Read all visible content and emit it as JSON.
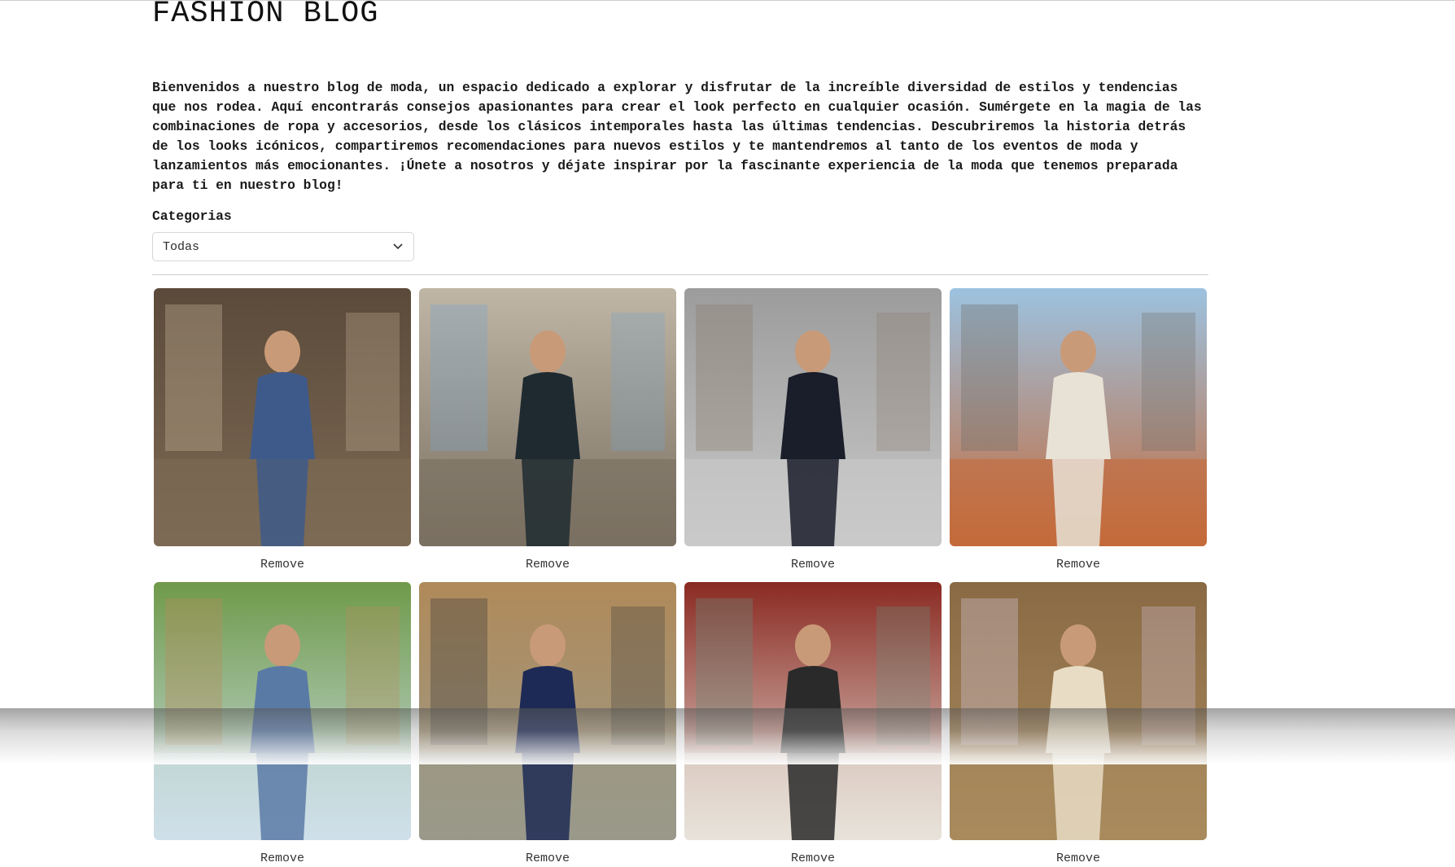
{
  "header": {
    "title": "FASHION BLOG"
  },
  "intro": {
    "text": "Bienvenidos a nuestro blog de moda, un espacio dedicado a explorar y disfrutar de la increíble diversidad de estilos y tendencias que nos rodea. Aquí encontrarás consejos apasionantes para crear el look perfecto en cualquier ocasión. Sumérgete en la magia de las combinaciones de ropa y accesorios, desde los clásicos intemporales hasta las últimas tendencias. Descubriremos la historia detrás de los looks icónicos, compartiremos recomendaciones para nuevos estilos y te mantendremos al tanto de los eventos de moda y lanzamientos más emocionantes. ¡Únete a nosotros y déjate inspirar por la fascinante experiencia de la moda que tenemos preparada para ti en nuestro blog!"
  },
  "filter": {
    "label": "Categorias",
    "selected": "Todas",
    "icon": "chevron-down-icon"
  },
  "posts": [
    {
      "remove_label": "Remove",
      "colors": [
        "#5b4a3a",
        "#7d6a55",
        "#3e5a8a",
        "#c9b79a"
      ]
    },
    {
      "remove_label": "Remove",
      "colors": [
        "#bfb6a6",
        "#7a6f60",
        "#1f2a30",
        "#7aa2c8"
      ]
    },
    {
      "remove_label": "Remove",
      "colors": [
        "#9c9c9c",
        "#c9c9c9",
        "#1a1d2a",
        "#8a7a6a"
      ]
    },
    {
      "remove_label": "Remove",
      "colors": [
        "#9cc2e0",
        "#c46a3a",
        "#e8e2d6",
        "#6e6e66"
      ]
    },
    {
      "remove_label": "Remove",
      "colors": [
        "#6f9a4a",
        "#cfe0ea",
        "#5a7aa6",
        "#b98a5a"
      ]
    },
    {
      "remove_label": "Remove",
      "colors": [
        "#b08a5a",
        "#9a9a8a",
        "#1d2a55",
        "#3a3a3a"
      ]
    },
    {
      "remove_label": "Remove",
      "colors": [
        "#8a2a22",
        "#e8e3da",
        "#2a2a2a",
        "#6a8a7a"
      ]
    },
    {
      "remove_label": "Remove",
      "colors": [
        "#8a6a44",
        "#a88a5e",
        "#e8dcc4",
        "#d8c8e0"
      ]
    }
  ]
}
